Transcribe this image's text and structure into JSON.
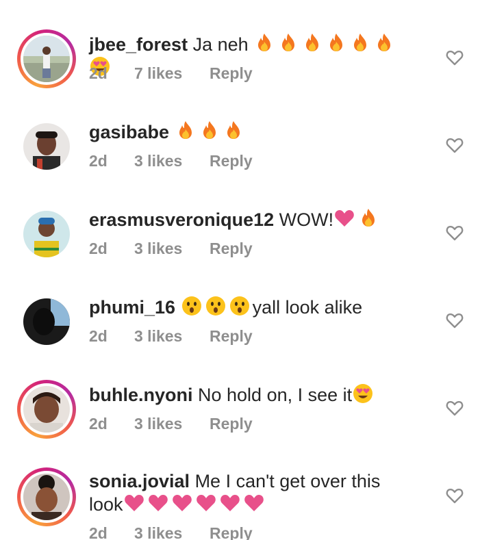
{
  "comments": [
    {
      "username": "jbee_forest",
      "text": " Ja neh ",
      "emojis": [
        "fire",
        "fire",
        "fire",
        "fire",
        "fire",
        "fire",
        "heart-eyes"
      ],
      "time": "2d",
      "likes": "7 likes",
      "reply": "Reply",
      "story_ring": true
    },
    {
      "username": "gasibabe",
      "text": " ",
      "emojis": [
        "fire",
        "fire",
        "fire"
      ],
      "time": "2d",
      "likes": "3 likes",
      "reply": "Reply",
      "story_ring": false
    },
    {
      "username": "erasmusveronique12",
      "text": " WOW!",
      "emojis": [
        "pink-heart",
        "fire"
      ],
      "time": "2d",
      "likes": "3 likes",
      "reply": "Reply",
      "story_ring": false
    },
    {
      "username": "phumi_16",
      "text": " ",
      "emojis": [
        "hushed-face",
        "hushed-face",
        "hushed-face"
      ],
      "text_after": "yall look alike",
      "time": "2d",
      "likes": "3 likes",
      "reply": "Reply",
      "story_ring": false
    },
    {
      "username": "buhle.nyoni",
      "text": " No hold on, I see it",
      "emojis": [
        "heart-eyes"
      ],
      "time": "2d",
      "likes": "3 likes",
      "reply": "Reply",
      "story_ring": true
    },
    {
      "username": "sonia.jovial",
      "text": " Me I can't get over this look",
      "emojis": [
        "pink-heart",
        "pink-heart",
        "pink-heart",
        "pink-heart",
        "pink-heart",
        "pink-heart"
      ],
      "time": "2d",
      "likes": "3 likes",
      "reply": "Reply",
      "story_ring": true
    }
  ],
  "colors": {
    "text": "#262626",
    "meta": "#8e8e8e",
    "heart_outline": "#8e8e8e",
    "pink_heart": "#e8508a",
    "fire_outer": "#f4771f",
    "fire_inner": "#fcc12e"
  }
}
